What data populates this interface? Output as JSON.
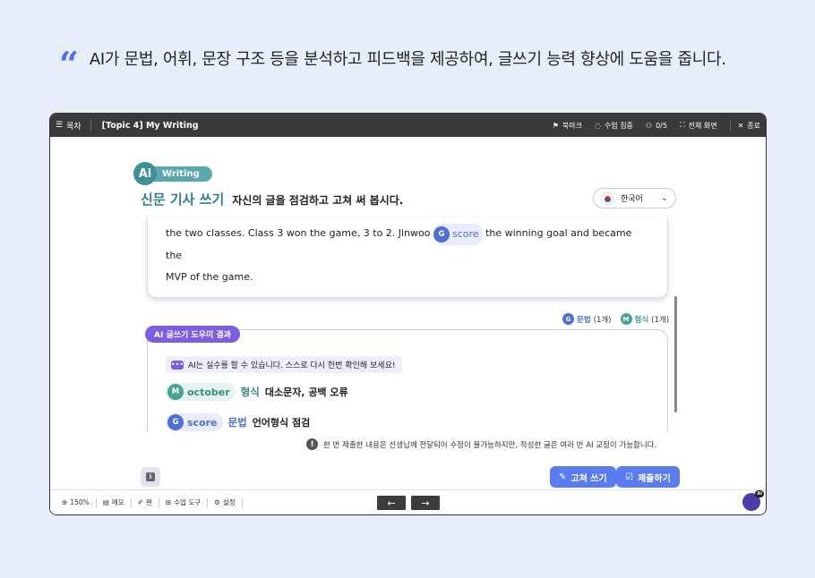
{
  "caption": {
    "quote_glyph": "“",
    "text": "AI가 문법, 어휘, 문장 구조 등을 분석하고 피드백을 제공하여, 글쓰기 능력 향상에 도움을 줍니다."
  },
  "topbar": {
    "menu_label": "목차",
    "title": "[Topic 4] My Writing",
    "bookmark": "북마크",
    "focus": "수업 집중",
    "participants": "0/5",
    "fullscreen": "전체 화면",
    "close": "종료"
  },
  "badge": {
    "ai": "Ai",
    "label": "Writing"
  },
  "heading": {
    "main": "신문 기사 쓰기",
    "sub": "자신의 글을 점검하고 고쳐 써 봅시다."
  },
  "language": {
    "selected": "한국어"
  },
  "writing": {
    "line1_before": "the two classes. Class 3 won the game, 3 to 2. Jinwoo",
    "chip_letter": "G",
    "chip_word": "score",
    "line1_after": "the winning goal and became the",
    "line2": "MVP of the game."
  },
  "legend": {
    "grammar_letter": "G",
    "grammar_label": "문법",
    "grammar_count": "(1개)",
    "form_letter": "M",
    "form_label": "형식",
    "form_count": "(1개)"
  },
  "result": {
    "tab": "AI 글쓰기 도우미 결과",
    "note": "AI는 실수를 할 수 있습니다. 스스로 다시 한번 확인해 보세요!",
    "items": [
      {
        "letter": "M",
        "word": "october",
        "type": "형식",
        "desc": "대소문자, 공백 오류"
      },
      {
        "letter": "G",
        "word": "score",
        "type": "문법",
        "desc": "언어형식 점검"
      }
    ]
  },
  "warning": "한 번 제출한 내용은 선생님께 전달되어 수정이 불가능하지만, 작성한 글은 여러 번 AI 교정이 가능합니다.",
  "buttons": {
    "rewrite": "고쳐 쓰기",
    "submit": "제출하기"
  },
  "bottombar": {
    "zoom": "150%",
    "memo": "메모",
    "pen": "펜",
    "tools": "수업 도구",
    "settings": "설정",
    "bot_badge": "AI"
  }
}
